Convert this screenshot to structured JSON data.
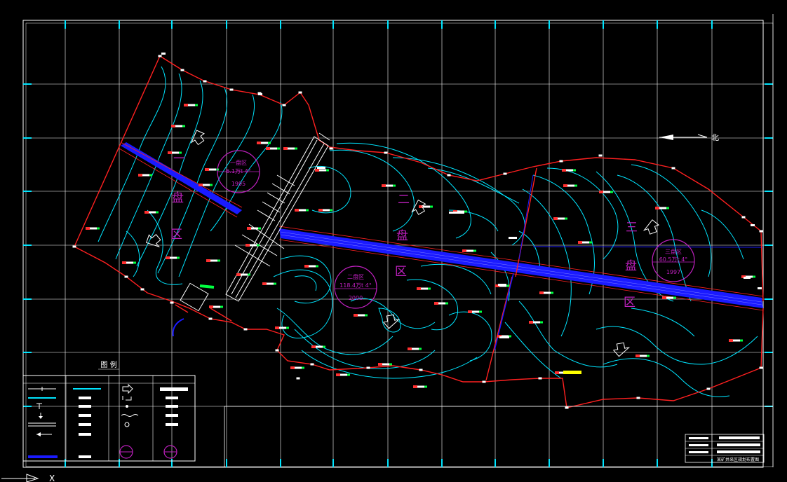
{
  "drawing": {
    "background": "#000000",
    "colors": {
      "frame": "#ffffff",
      "grid": "#ffffff",
      "tick": "#00e5ff",
      "contour": "#00e5ff",
      "boundary": "#ff2020",
      "boundary_dots": "#ffffff",
      "roadway": "#1a1aff",
      "panel_text": "#c020c0",
      "marker": "#ff3030",
      "highlight_green": "#00ff40",
      "highlight_yellow": "#ffff00"
    },
    "panels": [
      {
        "id": "panel-1",
        "chars": [
          "一",
          "盘",
          "区"
        ],
        "circle_lines": [
          "一盘区",
          "6.1万t  4°",
          "1995"
        ]
      },
      {
        "id": "panel-2",
        "chars": [
          "二",
          "盘",
          "区"
        ],
        "circle_lines": [
          "二盘区",
          "118.4万t  4°",
          "2000"
        ]
      },
      {
        "id": "panel-3",
        "chars": [
          "三",
          "盘",
          "区"
        ],
        "circle_lines": [
          "三盘区",
          "60.5万t  4°",
          "1997"
        ]
      }
    ],
    "north_arrow": {
      "label": "北"
    },
    "legend": {
      "title": "图  例",
      "rows": [
        [
          "line-cross",
          "cyan-line",
          "arrow-right",
          "wide-bar"
        ],
        [
          "cyan-line",
          "bar",
          "stair-icon",
          "bar"
        ],
        [
          "t-symbol",
          "bar",
          "dot-icon",
          "bar"
        ],
        [
          "arrow-down",
          "bar",
          "wave",
          "bar"
        ],
        [
          "double-line",
          "bar",
          "circle-icon",
          "bar"
        ],
        [
          "arrow-left",
          "bar",
          "magenta-circle",
          "magenta-circle"
        ],
        [
          "blue-line",
          "bar",
          "",
          ""
        ]
      ]
    },
    "title_block": {
      "label": "某矿井采区规划布置图"
    },
    "ucs": {
      "x": "X"
    }
  }
}
